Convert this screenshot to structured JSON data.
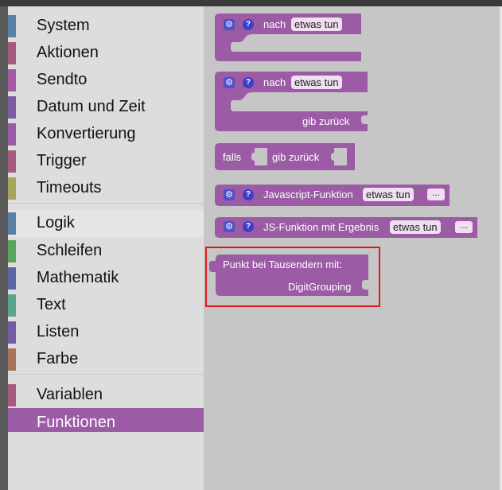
{
  "colors": {
    "procedure_block": "#9b5ba5",
    "selected_category": "#9b5ba5",
    "highlight": "#e0181d"
  },
  "categories": [
    {
      "label": "System",
      "color": "#5b80a5"
    },
    {
      "label": "Aktionen",
      "color": "#a55b80"
    },
    {
      "label": "Sendto",
      "color": "#a55ba5"
    },
    {
      "label": "Datum und Zeit",
      "color": "#805ba5"
    },
    {
      "label": "Konvertierung",
      "color": "#995ba5"
    },
    {
      "label": "Trigger",
      "color": "#a55b80"
    },
    {
      "label": "Timeouts",
      "color": "#a5a55b"
    },
    {
      "label": "Logik",
      "color": "#5b80a5"
    },
    {
      "label": "Schleifen",
      "color": "#5ba55b"
    },
    {
      "label": "Mathematik",
      "color": "#5b67a5"
    },
    {
      "label": "Text",
      "color": "#5ba58c"
    },
    {
      "label": "Listen",
      "color": "#745ba5"
    },
    {
      "label": "Farbe",
      "color": "#a5745b"
    },
    {
      "label": "Variablen",
      "color": "#a55b80"
    },
    {
      "label": "Funktionen",
      "color": "#9a5ca6"
    }
  ],
  "selected_category": "Funktionen",
  "blocks": {
    "proc_noreturn": {
      "label": "nach",
      "field": "etwas tun"
    },
    "proc_return": {
      "label": "nach",
      "field": "etwas tun",
      "return_label": "gib zurück"
    },
    "if_return": {
      "label": "falls",
      "return_label": "gib zurück"
    },
    "js_function": {
      "label": "Javascript-Funktion",
      "field": "etwas tun",
      "dots": "..."
    },
    "js_function_result": {
      "label": "JS-Funktion mit Ergebnis",
      "field": "etwas tun",
      "dots": "..."
    },
    "digit_grouping": {
      "line1": "Punkt bei Tausendern mit:",
      "line2": "DigitGrouping"
    }
  },
  "icons": {
    "gear": "gear-icon",
    "help": "question-mark-icon"
  }
}
